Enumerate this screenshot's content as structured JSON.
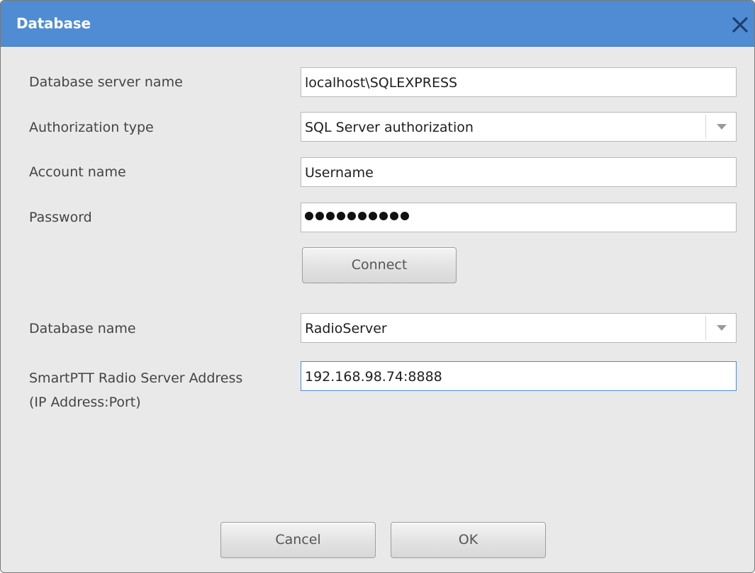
{
  "dialog": {
    "title": "Database",
    "close_icon": "close-icon"
  },
  "form": {
    "server_name": {
      "label": "Database server name",
      "value": "localhost\\SQLEXPRESS"
    },
    "auth_type": {
      "label": "Authorization type",
      "value": "SQL Server authorization"
    },
    "account_name": {
      "label": "Account name",
      "value": "Username"
    },
    "password": {
      "label": "Password",
      "masked_length": 10
    },
    "connect_label": "Connect",
    "database_name": {
      "label": "Database name",
      "value": "RadioServer"
    },
    "server_address": {
      "label_line1": "SmartPTT Radio Server Address",
      "label_line2": "(IP Address:Port)",
      "value": "192.168.98.74:8888"
    }
  },
  "footer": {
    "cancel_label": "Cancel",
    "ok_label": "OK"
  },
  "colors": {
    "titlebar": "#4f8cd4",
    "dialog_bg": "#e9e9e9",
    "focus_border": "#4f8cd4"
  }
}
